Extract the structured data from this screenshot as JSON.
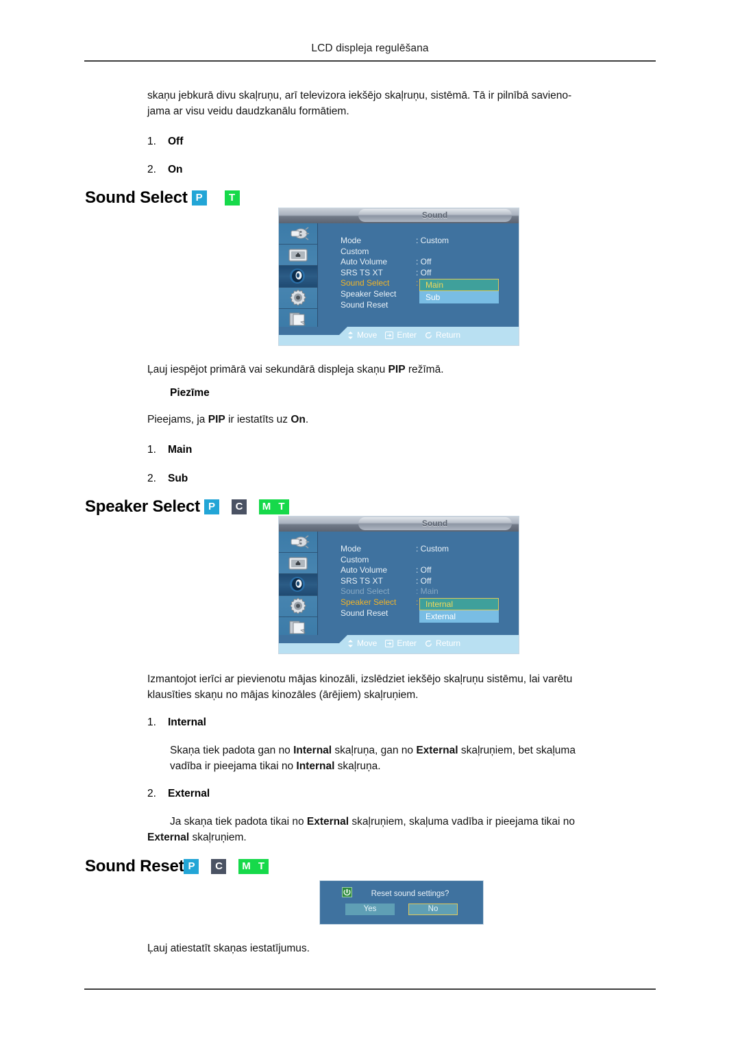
{
  "header": {
    "title": "LCD displeja regulēšana"
  },
  "intro": {
    "paragraph": "skaņu jebkurā divu skaļruņu, arī televizora iekšējo skaļruņu, sistēmā. Tā ir pilnībā savieno-jama ar visu veidu daudzkanālu formātiem.",
    "line1": "skaņu jebkurā divu skaļruņu, arī televizora iekšējo skaļruņu, sistēmā. Tā ir pilnībā savieno-",
    "line2": "jama ar visu veidu daudzkanālu formātiem.",
    "items": [
      {
        "num": "1.",
        "label": "Off"
      },
      {
        "num": "2.",
        "label": "On"
      }
    ]
  },
  "sound_select": {
    "heading": "Sound Select",
    "badges": [
      "P",
      "T"
    ],
    "description": "Ļauj iespējot primārā vai sekundārā displeja skaņu PIP režīmā.",
    "desc_pre": "Ļauj iespējot primārā vai sekundārā displeja skaņu ",
    "desc_bold": "PIP",
    "desc_post": " režīmā.",
    "note_title": "Piezīme",
    "note_pre": "Pieejams, ja ",
    "note_b1": "PIP",
    "note_mid": " ir iestatīts uz ",
    "note_b2": "On",
    "note_post": ".",
    "items": [
      {
        "num": "1.",
        "label": "Main"
      },
      {
        "num": "2.",
        "label": "Sub"
      }
    ],
    "osd": {
      "title": "Sound",
      "rows": [
        {
          "label": "Mode",
          "value": ": Custom",
          "state": "normal"
        },
        {
          "label": "Custom",
          "value": "",
          "state": "normal"
        },
        {
          "label": "Auto Volume",
          "value": ": Off",
          "state": "normal"
        },
        {
          "label": "SRS TS XT",
          "value": ": Off",
          "state": "normal"
        },
        {
          "label": "Sound Select",
          "value": ":",
          "state": "active"
        },
        {
          "label": "Speaker Select",
          "value": "",
          "state": "normal"
        },
        {
          "label": "Sound Reset",
          "value": "",
          "state": "normal"
        }
      ],
      "dropdown": [
        {
          "label": "Main",
          "selected": true
        },
        {
          "label": "Sub",
          "selected": false
        }
      ],
      "footer": [
        {
          "icon": "move-icon",
          "label": "Move"
        },
        {
          "icon": "enter-icon",
          "label": "Enter"
        },
        {
          "icon": "return-icon",
          "label": "Return"
        }
      ],
      "sidebar_icons": [
        "input-plug-icon",
        "picture-display-icon",
        "sound-speaker-icon",
        "setup-gear-icon",
        "multi-control-page-icon"
      ]
    }
  },
  "speaker_select": {
    "heading": "Speaker Select",
    "badges": [
      "P",
      "C",
      "M",
      "T"
    ],
    "desc_line1": "Izmantojot ierīci ar pievienotu mājas kinozāli, izslēdziet iekšējo skaļruņu sistēmu, lai varētu",
    "desc_line2": "klausīties skaņu no mājas kinozāles (ārējiem) skaļruņiem.",
    "items": [
      {
        "num": "1.",
        "label": "Internal",
        "body_line1_pre": "Skaņa tiek padota gan no ",
        "body_line1_b1": "Internal",
        "body_line1_mid": " skaļruņa, gan no ",
        "body_line1_b2": "External",
        "body_line1_post": " skaļruņiem, bet skaļuma",
        "body_line2_pre": "vadība ir pieejama tikai no ",
        "body_line2_b1": "Internal",
        "body_line2_post": " skaļruņa."
      },
      {
        "num": "2.",
        "label": "External",
        "body_line1_pre": "Ja skaņa tiek padota tikai no ",
        "body_line1_b1": "External",
        "body_line1_post": " skaļruņiem, skaļuma vadība ir pieejama tikai no",
        "body_line2_b1": "External",
        "body_line2_post": " skaļruņiem."
      }
    ],
    "osd": {
      "title": "Sound",
      "rows": [
        {
          "label": "Mode",
          "value": ": Custom",
          "state": "normal"
        },
        {
          "label": "Custom",
          "value": "",
          "state": "normal"
        },
        {
          "label": "Auto Volume",
          "value": ": Off",
          "state": "normal"
        },
        {
          "label": "SRS TS XT",
          "value": ": Off",
          "state": "normal"
        },
        {
          "label": "Sound Select",
          "value": ": Main",
          "state": "dim"
        },
        {
          "label": "Speaker Select",
          "value": ":",
          "state": "active"
        },
        {
          "label": "Sound Reset",
          "value": "",
          "state": "normal"
        }
      ],
      "dropdown": [
        {
          "label": "Internal",
          "selected": true
        },
        {
          "label": "External",
          "selected": false
        }
      ],
      "footer": [
        {
          "icon": "move-icon",
          "label": "Move"
        },
        {
          "icon": "enter-icon",
          "label": "Enter"
        },
        {
          "icon": "return-icon",
          "label": "Return"
        }
      ]
    }
  },
  "sound_reset": {
    "heading": "Sound Reset",
    "badges": [
      "P",
      "C",
      "M",
      "T"
    ],
    "dialog": {
      "icon": "power-reset-icon",
      "message": "Reset sound settings?",
      "yes_label": "Yes",
      "no_label": "No"
    },
    "description": "Ļauj atiestatīt skaņas iestatījumus."
  }
}
